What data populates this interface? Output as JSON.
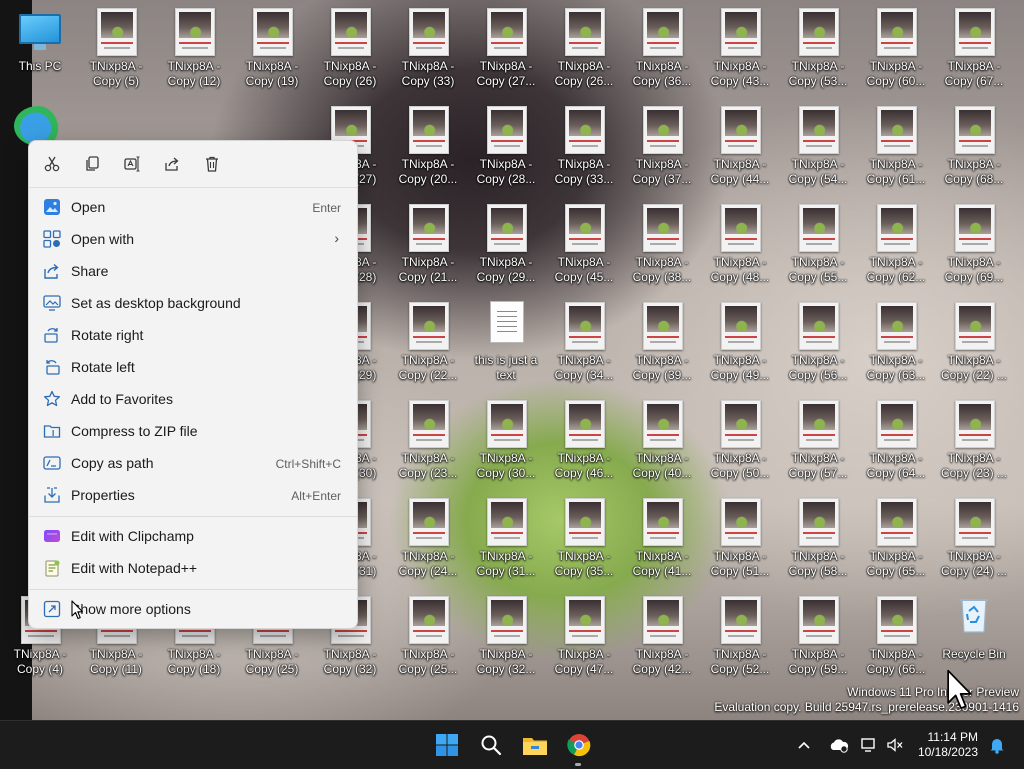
{
  "desktop": {
    "icons": [
      {
        "label": "This PC",
        "type": "pc",
        "col": 0,
        "row": 0
      },
      {
        "label": "TNixp8A -\nCopy (5)",
        "col": 1,
        "row": 0
      },
      {
        "label": "TNixp8A -\nCopy (12)",
        "col": 2,
        "row": 0
      },
      {
        "label": "TNixp8A -\nCopy (19)",
        "col": 3,
        "row": 0
      },
      {
        "label": "TNixp8A -\nCopy (26)",
        "col": 4,
        "row": 0
      },
      {
        "label": "TNixp8A -\nCopy (33)",
        "col": 5,
        "row": 0
      },
      {
        "label": "TNixp8A -\nCopy (27...",
        "col": 6,
        "row": 0
      },
      {
        "label": "TNixp8A -\nCopy (26...",
        "col": 7,
        "row": 0
      },
      {
        "label": "TNixp8A -\nCopy (36...",
        "col": 8,
        "row": 0
      },
      {
        "label": "TNixp8A -\nCopy (43...",
        "col": 9,
        "row": 0
      },
      {
        "label": "TNixp8A -\nCopy (53...",
        "col": 10,
        "row": 0
      },
      {
        "label": "TNixp8A -\nCopy (60...",
        "col": 11,
        "row": 0
      },
      {
        "label": "TNixp8A -\nCopy (67...",
        "col": 12,
        "row": 0
      },
      {
        "label": "TNixp8A -\nCopy (27)",
        "col": 4,
        "row": 1
      },
      {
        "label": "TNixp8A -\nCopy (20...",
        "col": 5,
        "row": 1
      },
      {
        "label": "TNixp8A -\nCopy (28...",
        "col": 6,
        "row": 1
      },
      {
        "label": "TNixp8A -\nCopy (33...",
        "col": 7,
        "row": 1
      },
      {
        "label": "TNixp8A -\nCopy (37...",
        "col": 8,
        "row": 1
      },
      {
        "label": "TNixp8A -\nCopy (44...",
        "col": 9,
        "row": 1
      },
      {
        "label": "TNixp8A -\nCopy (54...",
        "col": 10,
        "row": 1
      },
      {
        "label": "TNixp8A -\nCopy (61...",
        "col": 11,
        "row": 1
      },
      {
        "label": "TNixp8A -\nCopy (68...",
        "col": 12,
        "row": 1
      },
      {
        "label": "TNixp8A -\nCopy (28)",
        "col": 4,
        "row": 2
      },
      {
        "label": "TNixp8A -\nCopy (21...",
        "col": 5,
        "row": 2
      },
      {
        "label": "TNixp8A -\nCopy (29...",
        "col": 6,
        "row": 2
      },
      {
        "label": "TNixp8A -\nCopy (45...",
        "col": 7,
        "row": 2
      },
      {
        "label": "TNixp8A -\nCopy (38...",
        "col": 8,
        "row": 2
      },
      {
        "label": "TNixp8A -\nCopy (48...",
        "col": 9,
        "row": 2
      },
      {
        "label": "TNixp8A -\nCopy (55...",
        "col": 10,
        "row": 2
      },
      {
        "label": "TNixp8A -\nCopy (62...",
        "col": 11,
        "row": 2
      },
      {
        "label": "TNixp8A -\nCopy (69...",
        "col": 12,
        "row": 2
      },
      {
        "label": "TNixp8A -\nCopy (29)",
        "col": 4,
        "row": 3
      },
      {
        "label": "TNixp8A -\nCopy (22...",
        "col": 5,
        "row": 3
      },
      {
        "label": "this is just a\ntext",
        "type": "text",
        "col": 6,
        "row": 3
      },
      {
        "label": "TNixp8A -\nCopy (34...",
        "col": 7,
        "row": 3
      },
      {
        "label": "TNixp8A -\nCopy (39...",
        "col": 8,
        "row": 3
      },
      {
        "label": "TNixp8A -\nCopy (49...",
        "col": 9,
        "row": 3
      },
      {
        "label": "TNixp8A -\nCopy (56...",
        "col": 10,
        "row": 3
      },
      {
        "label": "TNixp8A -\nCopy (63...",
        "col": 11,
        "row": 3
      },
      {
        "label": "TNixp8A -\nCopy (22) ...",
        "col": 12,
        "row": 3
      },
      {
        "label": "TNixp8A -\nCopy (30)",
        "col": 4,
        "row": 4
      },
      {
        "label": "TNixp8A -\nCopy (23...",
        "col": 5,
        "row": 4
      },
      {
        "label": "TNixp8A -\nCopy (30...",
        "col": 6,
        "row": 4
      },
      {
        "label": "TNixp8A -\nCopy (46...",
        "col": 7,
        "row": 4
      },
      {
        "label": "TNixp8A -\nCopy (40...",
        "col": 8,
        "row": 4
      },
      {
        "label": "TNixp8A -\nCopy (50...",
        "col": 9,
        "row": 4
      },
      {
        "label": "TNixp8A -\nCopy (57...",
        "col": 10,
        "row": 4
      },
      {
        "label": "TNixp8A -\nCopy (64...",
        "col": 11,
        "row": 4
      },
      {
        "label": "TNixp8A -\nCopy (23) ...",
        "col": 12,
        "row": 4
      },
      {
        "label": "TNixp8A -\nCopy (31)",
        "col": 4,
        "row": 5
      },
      {
        "label": "TNixp8A -\nCopy (24...",
        "col": 5,
        "row": 5
      },
      {
        "label": "TNixp8A -\nCopy (31...",
        "col": 6,
        "row": 5
      },
      {
        "label": "TNixp8A -\nCopy (35...",
        "col": 7,
        "row": 5
      },
      {
        "label": "TNixp8A -\nCopy (41...",
        "col": 8,
        "row": 5
      },
      {
        "label": "TNixp8A -\nCopy (51...",
        "col": 9,
        "row": 5
      },
      {
        "label": "TNixp8A -\nCopy (58...",
        "col": 10,
        "row": 5
      },
      {
        "label": "TNixp8A -\nCopy (65...",
        "col": 11,
        "row": 5
      },
      {
        "label": "TNixp8A -\nCopy (24) ...",
        "col": 12,
        "row": 5
      },
      {
        "label": "TNixp8A -\nCopy (4)",
        "col": 0,
        "row": 6
      },
      {
        "label": "TNixp8A -\nCopy (11)",
        "col": 1,
        "row": 6
      },
      {
        "label": "TNixp8A -\nCopy (18)",
        "col": 2,
        "row": 6
      },
      {
        "label": "TNixp8A -\nCopy (25)",
        "col": 3,
        "row": 6
      },
      {
        "label": "TNixp8A -\nCopy (32)",
        "col": 4,
        "row": 6
      },
      {
        "label": "TNixp8A -\nCopy (25...",
        "col": 5,
        "row": 6
      },
      {
        "label": "TNixp8A -\nCopy (32...",
        "col": 6,
        "row": 6
      },
      {
        "label": "TNixp8A -\nCopy (47...",
        "col": 7,
        "row": 6
      },
      {
        "label": "TNixp8A -\nCopy (42...",
        "col": 8,
        "row": 6
      },
      {
        "label": "TNixp8A -\nCopy (52...",
        "col": 9,
        "row": 6
      },
      {
        "label": "TNixp8A -\nCopy (59...",
        "col": 10,
        "row": 6
      },
      {
        "label": "TNixp8A -\nCopy (66...",
        "col": 11,
        "row": 6
      },
      {
        "label": "Recycle Bin",
        "type": "bin",
        "col": 12,
        "row": 6
      }
    ]
  },
  "watermark": {
    "line1": "Windows 11 Pro Insider Preview",
    "line2": "Evaluation copy. Build 25947.rs_prerelease.230901-1416"
  },
  "context_menu": {
    "quick_actions": [
      "cut-icon",
      "copy-icon",
      "rename-icon",
      "share-icon",
      "delete-icon"
    ],
    "items": [
      {
        "label": "Open",
        "shortcut": "Enter",
        "icon": "open-icon"
      },
      {
        "label": "Open with",
        "shortcut": "",
        "icon": "open-with-icon",
        "submenu": true
      },
      {
        "label": "Share",
        "shortcut": "",
        "icon": "share-icon"
      },
      {
        "label": "Set as desktop background",
        "shortcut": "",
        "icon": "desktop-background-icon"
      },
      {
        "label": "Rotate right",
        "shortcut": "",
        "icon": "rotate-right-icon"
      },
      {
        "label": "Rotate left",
        "shortcut": "",
        "icon": "rotate-left-icon"
      },
      {
        "label": "Add to Favorites",
        "shortcut": "",
        "icon": "star-icon"
      },
      {
        "label": "Compress to ZIP file",
        "shortcut": "",
        "icon": "zip-icon"
      },
      {
        "label": "Copy as path",
        "shortcut": "Ctrl+Shift+C",
        "icon": "copy-path-icon"
      },
      {
        "label": "Properties",
        "shortcut": "Alt+Enter",
        "icon": "properties-icon"
      },
      {
        "label": "Edit with Clipchamp",
        "shortcut": "",
        "icon": "clipchamp-icon"
      },
      {
        "label": "Edit with Notepad++",
        "shortcut": "",
        "icon": "notepadpp-icon"
      },
      {
        "label": "Show more options",
        "shortcut": "",
        "icon": "more-options-icon"
      }
    ]
  },
  "taskbar": {
    "apps": [
      "start-icon",
      "search-icon",
      "file-explorer-icon",
      "chrome-icon"
    ],
    "tray": [
      "chevron-up-icon",
      "onedrive-icon",
      "network-icon",
      "volume-muted-icon",
      "notification-bell-icon"
    ],
    "time": "11:14 PM",
    "date": "10/18/2023"
  }
}
